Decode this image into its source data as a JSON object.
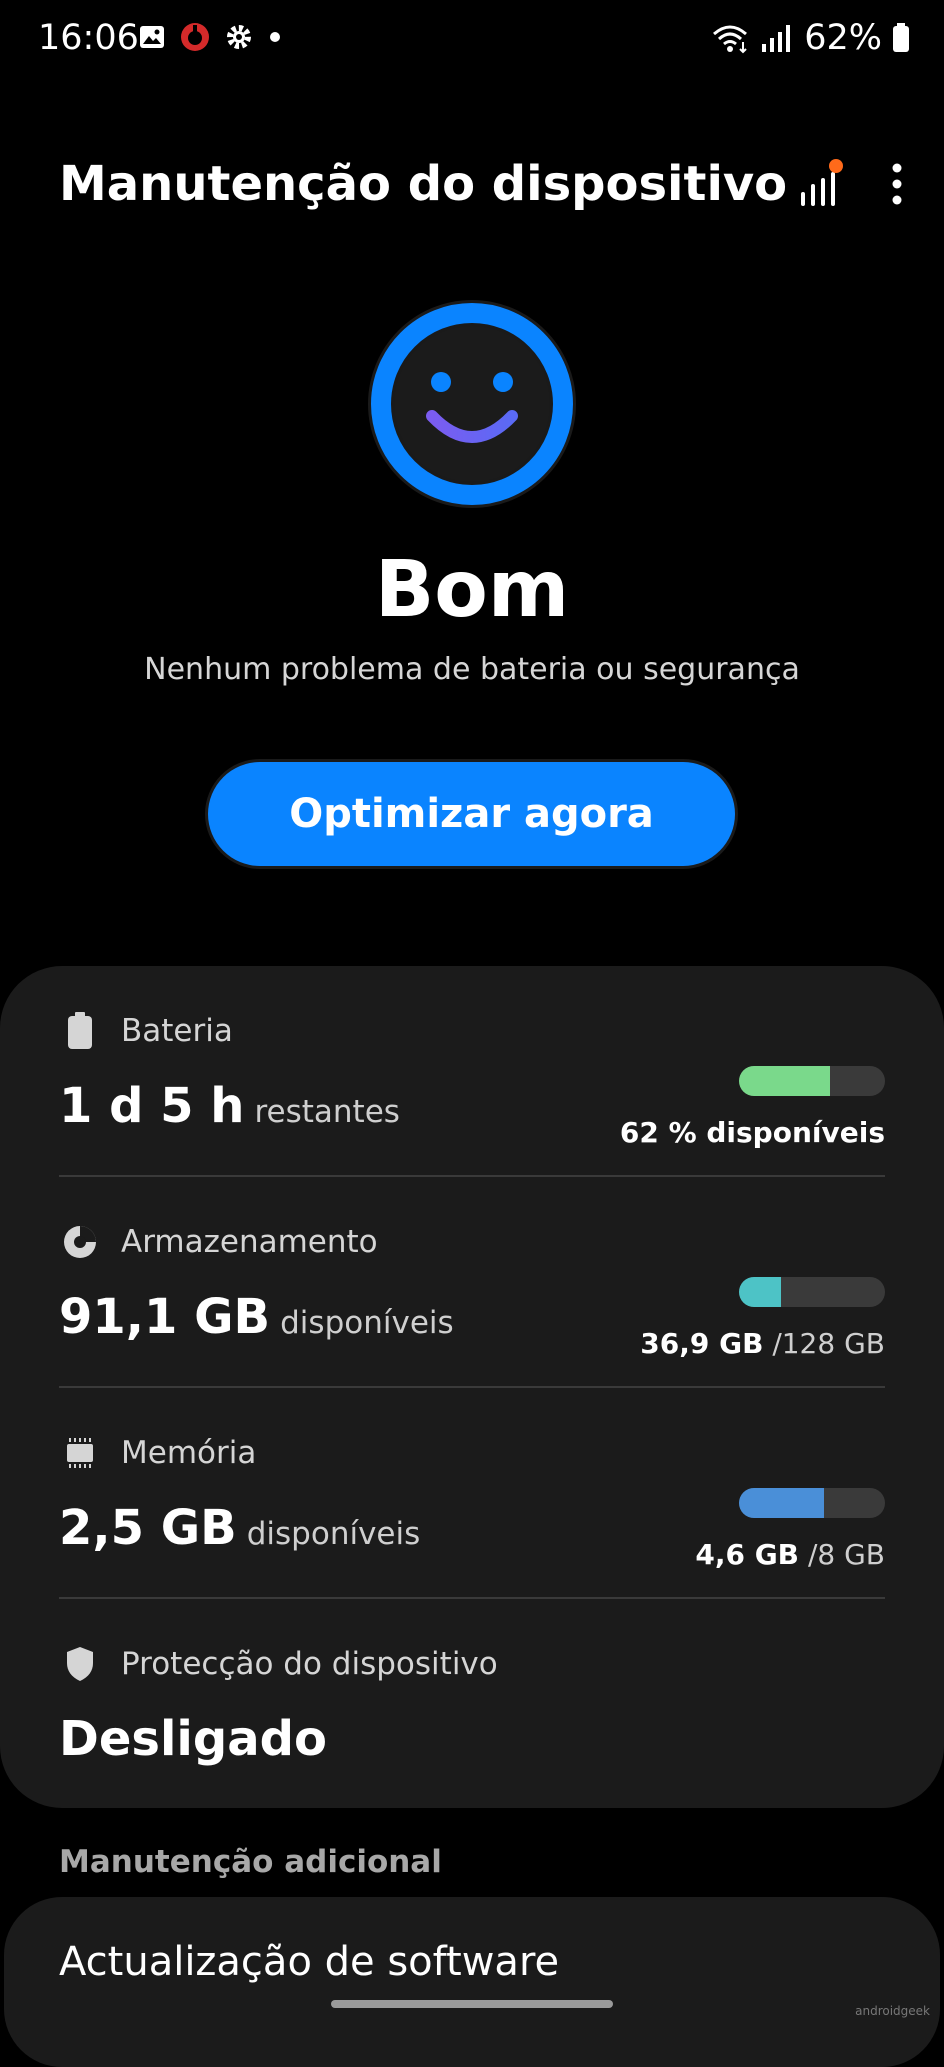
{
  "status_bar": {
    "time": "16:06",
    "battery_percent": "62%",
    "icons_left": [
      "gallery-icon",
      "app-notification-icon",
      "settings-icon",
      "dot-icon"
    ],
    "icons_right": [
      "wifi-icon",
      "signal-icon",
      "battery-icon"
    ]
  },
  "app_bar": {
    "title": "Manutenção do dispositivo",
    "actions": [
      "stats-icon",
      "more-options-icon"
    ]
  },
  "status": {
    "label": "Bom",
    "description": "Nenhum problema de bateria ou segurança",
    "face_color": "#0a84ff"
  },
  "optimize_button": {
    "label": "Optimizar agora"
  },
  "items": {
    "battery": {
      "label": "Bateria",
      "value": "1 d 5 h",
      "unit": "restantes",
      "summary": "62 % disponíveis",
      "level": 0.62,
      "color": "#7ad98b"
    },
    "storage": {
      "label": "Armazenamento",
      "value": "91,1 GB",
      "unit": "disponíveis",
      "used": "36,9 GB",
      "total": "/128 GB",
      "level": 0.29,
      "color": "#4dc3c6"
    },
    "memory": {
      "label": "Memória",
      "value": "2,5 GB",
      "unit": "disponíveis",
      "used": "4,6 GB",
      "total": "/8 GB",
      "level": 0.58,
      "color": "#4a8fd8"
    },
    "protection": {
      "label": "Protecção do dispositivo",
      "value": "Desligado"
    }
  },
  "additional": {
    "section_label": "Manutenção adicional",
    "software_update": "Actualização de software"
  },
  "watermark": "androidgeek"
}
